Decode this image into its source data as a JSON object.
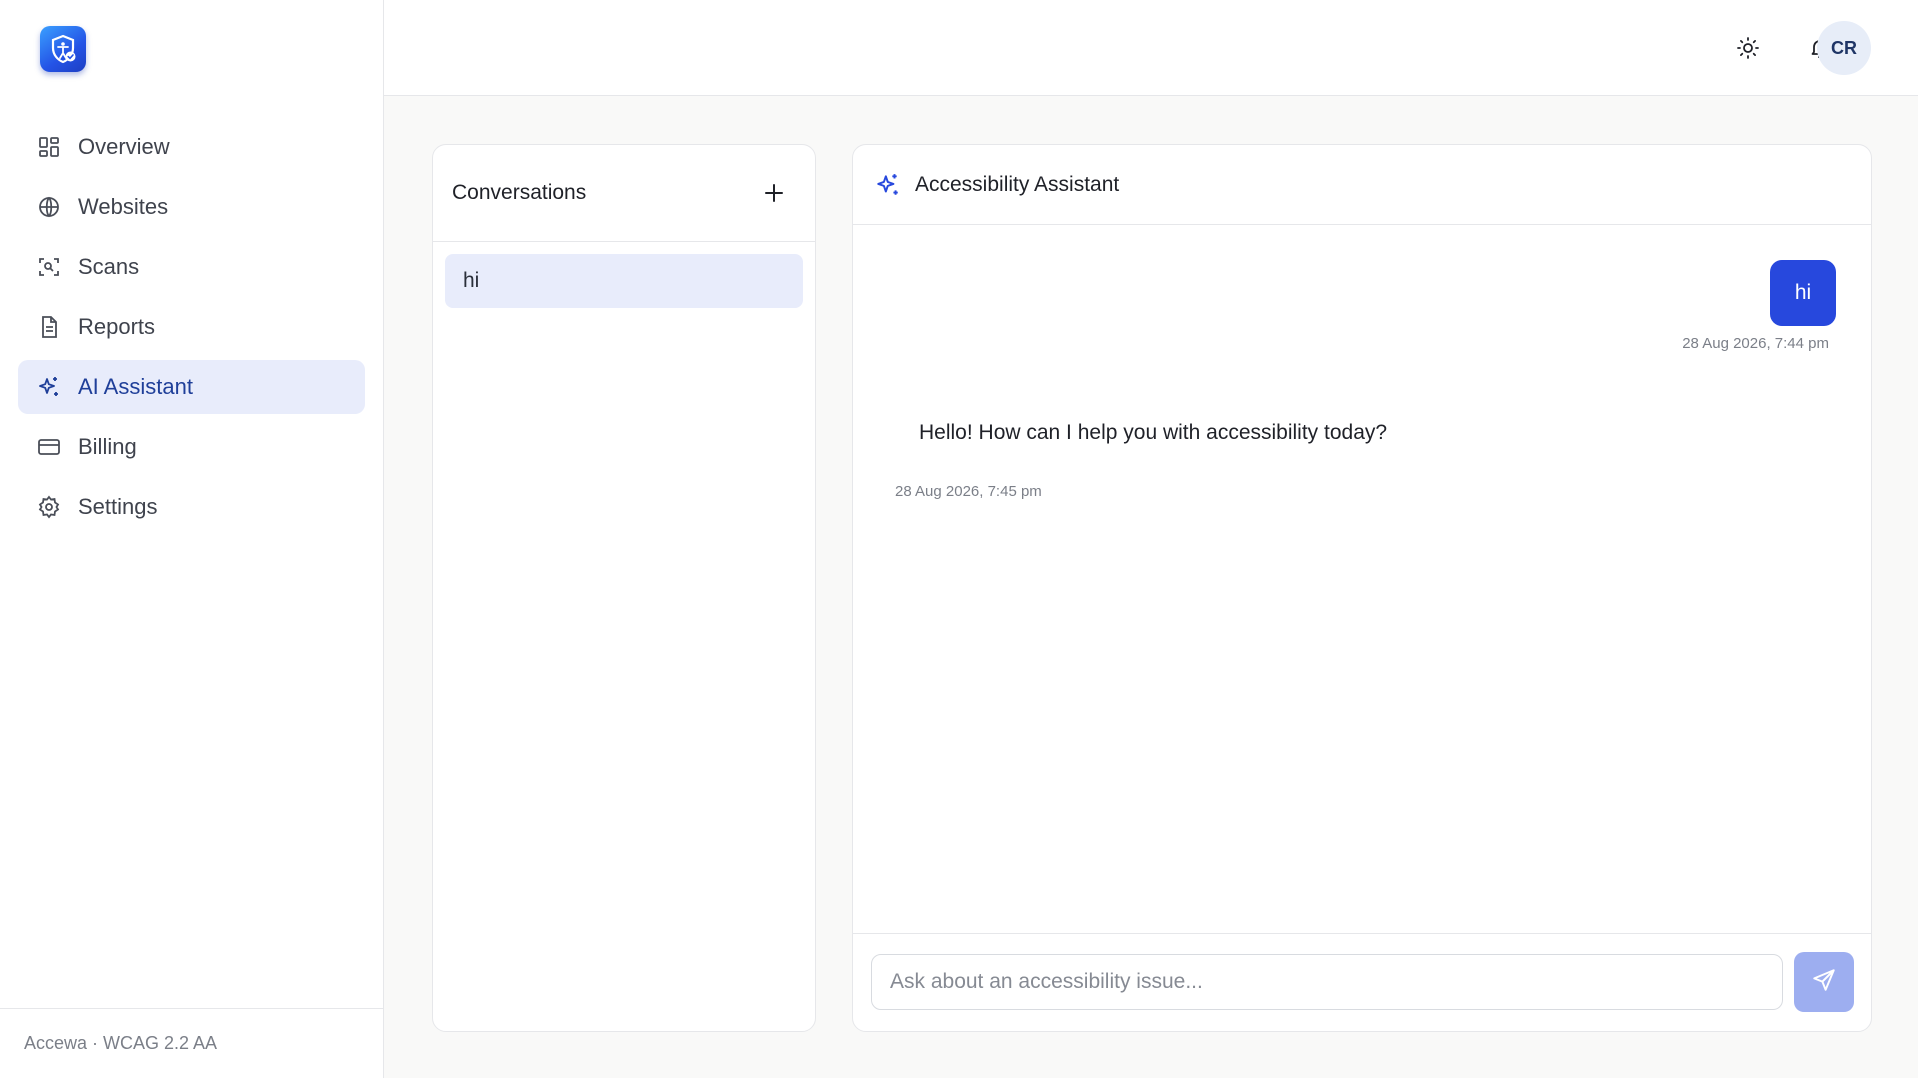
{
  "app": {
    "logo_icon": "accessibility-shield-icon",
    "brand_color": "#2748dd"
  },
  "sidebar": {
    "items": [
      {
        "label": "Overview",
        "icon": "dashboard-grid-icon",
        "active": false
      },
      {
        "label": "Websites",
        "icon": "globe-icon",
        "active": false
      },
      {
        "label": "Scans",
        "icon": "scan-icon",
        "active": false
      },
      {
        "label": "Reports",
        "icon": "document-icon",
        "active": false
      },
      {
        "label": "AI Assistant",
        "icon": "sparkles-icon",
        "active": true
      },
      {
        "label": "Billing",
        "icon": "credit-card-icon",
        "active": false
      },
      {
        "label": "Settings",
        "icon": "gear-icon",
        "active": false
      }
    ],
    "footer": "Accewa · WCAG 2.2 AA"
  },
  "topbar": {
    "theme_icon": "sun-icon",
    "notifications_icon": "bell-icon",
    "avatar_initials": "CR"
  },
  "conversations": {
    "title": "Conversations",
    "add_icon": "plus-icon",
    "items": [
      {
        "label": "hi",
        "selected": true
      }
    ]
  },
  "chat": {
    "title": "Accessibility Assistant",
    "title_icon": "sparkles-icon",
    "messages": [
      {
        "role": "user",
        "text": "hi",
        "timestamp": "28 Aug 2026, 7:44 pm"
      },
      {
        "role": "assistant",
        "text": "Hello! How can I help you with accessibility today?",
        "timestamp": "28 Aug 2026, 7:45 pm"
      }
    ],
    "input": {
      "value": "",
      "placeholder": "Ask about an accessibility issue..."
    },
    "send_icon": "send-icon"
  }
}
